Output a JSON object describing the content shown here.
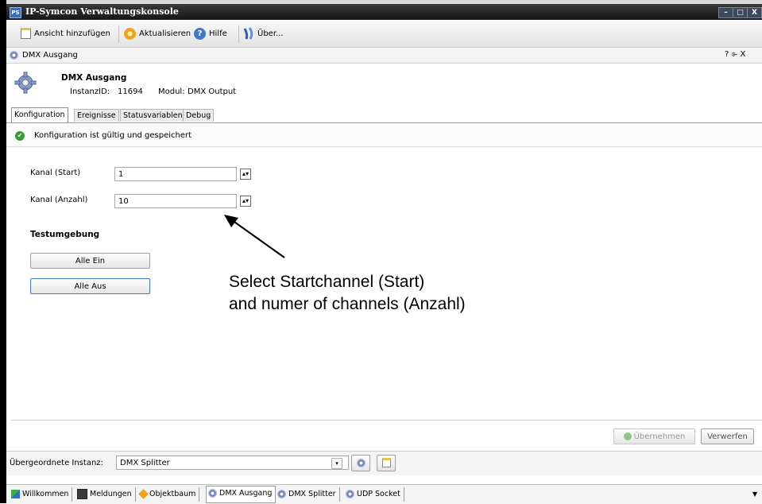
{
  "window": {
    "title": "IP-Symcon Verwaltungskonsole",
    "app_icon": "PS",
    "minimize": "–",
    "maximize": "□",
    "close": "X"
  },
  "toolbar": {
    "add_view": "Ansicht hinzufügen",
    "refresh": "Aktualisieren",
    "help": "Hilfe",
    "about": "Über..."
  },
  "view": {
    "title": "DMX Ausgang",
    "controls": "? ⌱ X"
  },
  "instance": {
    "name": "DMX Ausgang",
    "id_label": "InstanzID:",
    "id_value": "11694",
    "module_label": "Modul:",
    "module_value": "DMX Output"
  },
  "tabs": [
    "Konfiguration",
    "Ereignisse",
    "Statusvariablen",
    "Debug"
  ],
  "status": {
    "text": "Konfiguration ist gültig und gespeichert"
  },
  "form": {
    "start_label": "Kanal (Start)",
    "start_value": "1",
    "count_label": "Kanal (Anzahl)",
    "count_value": "10",
    "section_title": "Testumgebung",
    "all_on": "Alle Ein",
    "all_off": "Alle Aus"
  },
  "annotation": {
    "line1": "Select Startchannel (Start)",
    "line2": "and numer of channels (Anzahl)"
  },
  "actions": {
    "apply": "Übernehmen",
    "discard": "Verwerfen"
  },
  "parent": {
    "label": "Übergeordnete Instanz:",
    "value": "DMX Splitter"
  },
  "doc_tabs": [
    "Willkommen",
    "Meldungen",
    "Objektbaum",
    "DMX Ausgang",
    "DMX Splitter",
    "UDP Socket"
  ],
  "colors": {
    "titlebar": "#1e1e1e",
    "status_ok": "#3a9d2e",
    "focus": "#3d7bd0"
  }
}
